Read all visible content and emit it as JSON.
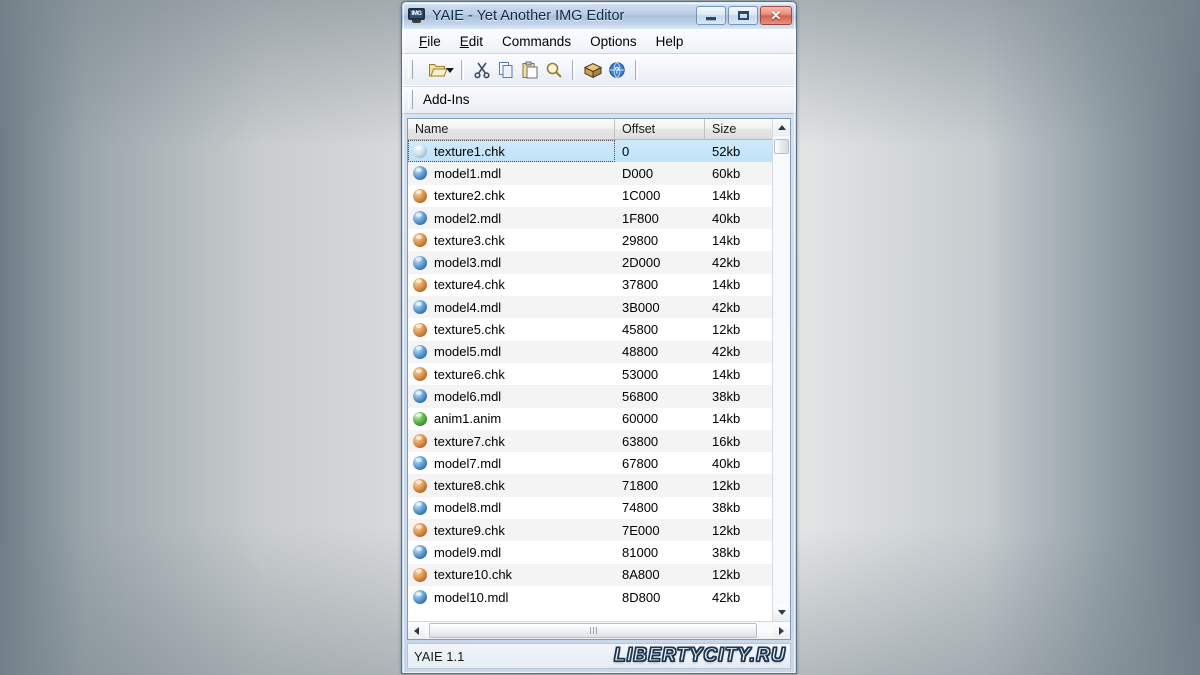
{
  "window": {
    "title": "YAIE - Yet Another IMG Editor",
    "app_icon": "img-monitor-icon",
    "icon_label": "IMG",
    "minimize_label": "",
    "maximize_label": "",
    "close_label": "✕"
  },
  "menu": {
    "items": [
      {
        "label": "File",
        "accel": "F"
      },
      {
        "label": "Edit",
        "accel": "E"
      },
      {
        "label": "Commands",
        "accel": "C"
      },
      {
        "label": "Options",
        "accel": "O"
      },
      {
        "label": "Help",
        "accel": "H"
      }
    ]
  },
  "toolbar": {
    "buttons": [
      {
        "name": "open-file-button",
        "icon": "open-folder-icon",
        "has_dropdown": true
      },
      {
        "name": "cut-button",
        "icon": "scissors-icon"
      },
      {
        "name": "copy-button",
        "icon": "copy-icon"
      },
      {
        "name": "paste-button",
        "icon": "paste-icon"
      },
      {
        "name": "find-button",
        "icon": "magnifier-icon"
      },
      {
        "name": "rebuild-button",
        "icon": "package-box-icon"
      },
      {
        "name": "help-button",
        "icon": "help-globe-icon"
      }
    ],
    "addins_label": "Add-Ins"
  },
  "list": {
    "columns": [
      "Name",
      "Offset",
      "Size"
    ],
    "rows": [
      {
        "name": "texture1.chk",
        "offset": "0",
        "size": "52kb",
        "icon": "texture-icon",
        "selected": true
      },
      {
        "name": "model1.mdl",
        "offset": "D000",
        "size": "60kb",
        "icon": "model-icon"
      },
      {
        "name": "texture2.chk",
        "offset": "1C000",
        "size": "14kb",
        "icon": "texture-icon"
      },
      {
        "name": "model2.mdl",
        "offset": "1F800",
        "size": "40kb",
        "icon": "model-icon"
      },
      {
        "name": "texture3.chk",
        "offset": "29800",
        "size": "14kb",
        "icon": "texture-icon"
      },
      {
        "name": "model3.mdl",
        "offset": "2D000",
        "size": "42kb",
        "icon": "model-icon"
      },
      {
        "name": "texture4.chk",
        "offset": "37800",
        "size": "14kb",
        "icon": "texture-icon"
      },
      {
        "name": "model4.mdl",
        "offset": "3B000",
        "size": "42kb",
        "icon": "model-icon"
      },
      {
        "name": "texture5.chk",
        "offset": "45800",
        "size": "12kb",
        "icon": "texture-icon"
      },
      {
        "name": "model5.mdl",
        "offset": "48800",
        "size": "42kb",
        "icon": "model-icon"
      },
      {
        "name": "texture6.chk",
        "offset": "53000",
        "size": "14kb",
        "icon": "texture-icon"
      },
      {
        "name": "model6.mdl",
        "offset": "56800",
        "size": "38kb",
        "icon": "model-icon"
      },
      {
        "name": "anim1.anim",
        "offset": "60000",
        "size": "14kb",
        "icon": "anim-icon"
      },
      {
        "name": "texture7.chk",
        "offset": "63800",
        "size": "16kb",
        "icon": "texture-icon"
      },
      {
        "name": "model7.mdl",
        "offset": "67800",
        "size": "40kb",
        "icon": "model-icon"
      },
      {
        "name": "texture8.chk",
        "offset": "71800",
        "size": "12kb",
        "icon": "texture-icon"
      },
      {
        "name": "model8.mdl",
        "offset": "74800",
        "size": "38kb",
        "icon": "model-icon"
      },
      {
        "name": "texture9.chk",
        "offset": "7E000",
        "size": "12kb",
        "icon": "texture-icon"
      },
      {
        "name": "model9.mdl",
        "offset": "81000",
        "size": "38kb",
        "icon": "model-icon"
      },
      {
        "name": "texture10.chk",
        "offset": "8A800",
        "size": "12kb",
        "icon": "texture-icon"
      },
      {
        "name": "model10.mdl",
        "offset": "8D800",
        "size": "42kb",
        "icon": "model-icon"
      }
    ]
  },
  "statusbar": {
    "text": "YAIE 1.1",
    "watermark": "LIBERTYCITY.RU"
  },
  "colors": {
    "titlebar_accent": "#a9c0dd",
    "selection": "#bfe2f8",
    "close_button": "#d2604c",
    "texture_icon": "#e09a54",
    "model_icon": "#2f6fa8",
    "anim_icon": "#2f8a2f",
    "list_border": "#7f9db9"
  }
}
